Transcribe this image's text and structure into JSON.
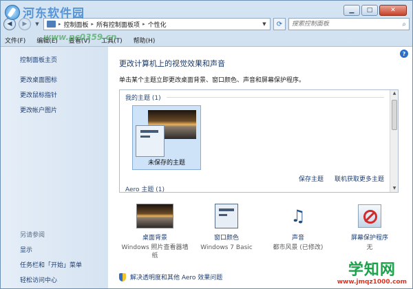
{
  "window": {
    "caption": {
      "minimize": "▁",
      "maximize": "□",
      "close": "✕"
    }
  },
  "address": {
    "crumbs": [
      "控制面板",
      "所有控制面板项",
      "个性化"
    ],
    "separator": "▸",
    "search_placeholder": "搜索控制面板"
  },
  "menu": {
    "items": [
      "文件(F)",
      "编辑(E)",
      "查看(V)",
      "工具(T)",
      "帮助(H)"
    ]
  },
  "sidebar": {
    "home": "控制面板主页",
    "links": [
      "更改桌面图标",
      "更改鼠标指针",
      "更改帐户图片"
    ],
    "see_also_heading": "另请参阅",
    "see_also": [
      "显示",
      "任务栏和「开始」菜单",
      "轻松访问中心"
    ]
  },
  "main": {
    "title": "更改计算机上的视觉效果和声音",
    "subtitle": "单击某个主题立即更改桌面背景、窗口颜色、声音和屏幕保护程序。",
    "my_themes": "我的主题 (1)",
    "theme_name": "未保存的主题",
    "save_theme": "保存主题",
    "get_more": "联机获取更多主题",
    "aero_themes": "Aero 主题 (1)",
    "tiles": [
      {
        "label": "桌面背景",
        "value": "Windows 照片查看器墙纸"
      },
      {
        "label": "窗口颜色",
        "value": "Windows 7 Basic"
      },
      {
        "label": "声音",
        "value": "都市风景 (已修改)"
      },
      {
        "label": "屏幕保护程序",
        "value": "无"
      }
    ],
    "troubleshoot": "解决透明度和其他 Aero 效果问题"
  },
  "watermarks": {
    "top_name": "河东软件园",
    "top_url": "www.pc0359.cn",
    "bottom_name": "学知网",
    "bottom_url": "www.jmqz1000.com"
  },
  "colors": {
    "link": "#1f3f73",
    "sidebar_bg": "#dde8f4",
    "close_button": "#c7432a"
  }
}
